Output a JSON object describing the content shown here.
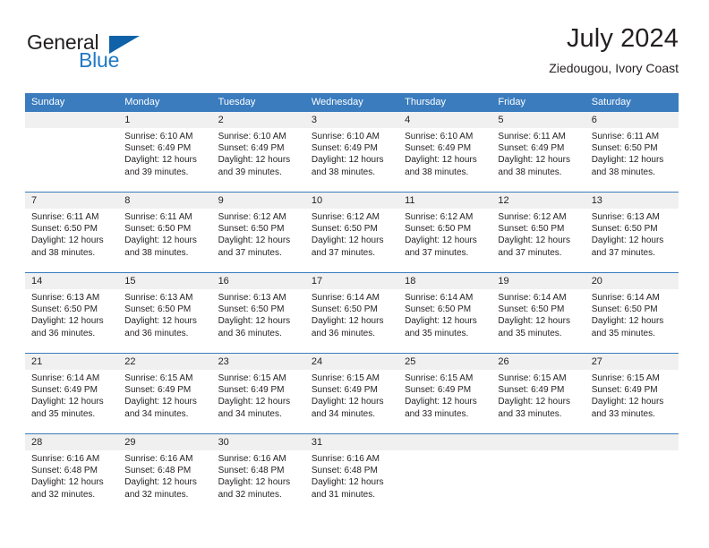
{
  "brand": {
    "name_part1": "General",
    "name_part2": "Blue",
    "triangle_color": "#0f62a8",
    "blue_color": "#2079c4"
  },
  "header": {
    "title": "July 2024",
    "subtitle": "Ziedougou, Ivory Coast"
  },
  "theme": {
    "header_bar_color": "#3a7cbe",
    "day_number_band_color": "#f0f0f0",
    "text_color": "#231f20"
  },
  "weekdays": [
    "Sunday",
    "Monday",
    "Tuesday",
    "Wednesday",
    "Thursday",
    "Friday",
    "Saturday"
  ],
  "weeks": [
    [
      {
        "day": "",
        "sunrise": "",
        "sunset": "",
        "daylight": "",
        "empty": true
      },
      {
        "day": "1",
        "sunrise": "Sunrise: 6:10 AM",
        "sunset": "Sunset: 6:49 PM",
        "daylight": "Daylight: 12 hours and 39 minutes."
      },
      {
        "day": "2",
        "sunrise": "Sunrise: 6:10 AM",
        "sunset": "Sunset: 6:49 PM",
        "daylight": "Daylight: 12 hours and 39 minutes."
      },
      {
        "day": "3",
        "sunrise": "Sunrise: 6:10 AM",
        "sunset": "Sunset: 6:49 PM",
        "daylight": "Daylight: 12 hours and 38 minutes."
      },
      {
        "day": "4",
        "sunrise": "Sunrise: 6:10 AM",
        "sunset": "Sunset: 6:49 PM",
        "daylight": "Daylight: 12 hours and 38 minutes."
      },
      {
        "day": "5",
        "sunrise": "Sunrise: 6:11 AM",
        "sunset": "Sunset: 6:49 PM",
        "daylight": "Daylight: 12 hours and 38 minutes."
      },
      {
        "day": "6",
        "sunrise": "Sunrise: 6:11 AM",
        "sunset": "Sunset: 6:50 PM",
        "daylight": "Daylight: 12 hours and 38 minutes."
      }
    ],
    [
      {
        "day": "7",
        "sunrise": "Sunrise: 6:11 AM",
        "sunset": "Sunset: 6:50 PM",
        "daylight": "Daylight: 12 hours and 38 minutes."
      },
      {
        "day": "8",
        "sunrise": "Sunrise: 6:11 AM",
        "sunset": "Sunset: 6:50 PM",
        "daylight": "Daylight: 12 hours and 38 minutes."
      },
      {
        "day": "9",
        "sunrise": "Sunrise: 6:12 AM",
        "sunset": "Sunset: 6:50 PM",
        "daylight": "Daylight: 12 hours and 37 minutes."
      },
      {
        "day": "10",
        "sunrise": "Sunrise: 6:12 AM",
        "sunset": "Sunset: 6:50 PM",
        "daylight": "Daylight: 12 hours and 37 minutes."
      },
      {
        "day": "11",
        "sunrise": "Sunrise: 6:12 AM",
        "sunset": "Sunset: 6:50 PM",
        "daylight": "Daylight: 12 hours and 37 minutes."
      },
      {
        "day": "12",
        "sunrise": "Sunrise: 6:12 AM",
        "sunset": "Sunset: 6:50 PM",
        "daylight": "Daylight: 12 hours and 37 minutes."
      },
      {
        "day": "13",
        "sunrise": "Sunrise: 6:13 AM",
        "sunset": "Sunset: 6:50 PM",
        "daylight": "Daylight: 12 hours and 37 minutes."
      }
    ],
    [
      {
        "day": "14",
        "sunrise": "Sunrise: 6:13 AM",
        "sunset": "Sunset: 6:50 PM",
        "daylight": "Daylight: 12 hours and 36 minutes."
      },
      {
        "day": "15",
        "sunrise": "Sunrise: 6:13 AM",
        "sunset": "Sunset: 6:50 PM",
        "daylight": "Daylight: 12 hours and 36 minutes."
      },
      {
        "day": "16",
        "sunrise": "Sunrise: 6:13 AM",
        "sunset": "Sunset: 6:50 PM",
        "daylight": "Daylight: 12 hours and 36 minutes."
      },
      {
        "day": "17",
        "sunrise": "Sunrise: 6:14 AM",
        "sunset": "Sunset: 6:50 PM",
        "daylight": "Daylight: 12 hours and 36 minutes."
      },
      {
        "day": "18",
        "sunrise": "Sunrise: 6:14 AM",
        "sunset": "Sunset: 6:50 PM",
        "daylight": "Daylight: 12 hours and 35 minutes."
      },
      {
        "day": "19",
        "sunrise": "Sunrise: 6:14 AM",
        "sunset": "Sunset: 6:50 PM",
        "daylight": "Daylight: 12 hours and 35 minutes."
      },
      {
        "day": "20",
        "sunrise": "Sunrise: 6:14 AM",
        "sunset": "Sunset: 6:50 PM",
        "daylight": "Daylight: 12 hours and 35 minutes."
      }
    ],
    [
      {
        "day": "21",
        "sunrise": "Sunrise: 6:14 AM",
        "sunset": "Sunset: 6:49 PM",
        "daylight": "Daylight: 12 hours and 35 minutes."
      },
      {
        "day": "22",
        "sunrise": "Sunrise: 6:15 AM",
        "sunset": "Sunset: 6:49 PM",
        "daylight": "Daylight: 12 hours and 34 minutes."
      },
      {
        "day": "23",
        "sunrise": "Sunrise: 6:15 AM",
        "sunset": "Sunset: 6:49 PM",
        "daylight": "Daylight: 12 hours and 34 minutes."
      },
      {
        "day": "24",
        "sunrise": "Sunrise: 6:15 AM",
        "sunset": "Sunset: 6:49 PM",
        "daylight": "Daylight: 12 hours and 34 minutes."
      },
      {
        "day": "25",
        "sunrise": "Sunrise: 6:15 AM",
        "sunset": "Sunset: 6:49 PM",
        "daylight": "Daylight: 12 hours and 33 minutes."
      },
      {
        "day": "26",
        "sunrise": "Sunrise: 6:15 AM",
        "sunset": "Sunset: 6:49 PM",
        "daylight": "Daylight: 12 hours and 33 minutes."
      },
      {
        "day": "27",
        "sunrise": "Sunrise: 6:15 AM",
        "sunset": "Sunset: 6:49 PM",
        "daylight": "Daylight: 12 hours and 33 minutes."
      }
    ],
    [
      {
        "day": "28",
        "sunrise": "Sunrise: 6:16 AM",
        "sunset": "Sunset: 6:48 PM",
        "daylight": "Daylight: 12 hours and 32 minutes."
      },
      {
        "day": "29",
        "sunrise": "Sunrise: 6:16 AM",
        "sunset": "Sunset: 6:48 PM",
        "daylight": "Daylight: 12 hours and 32 minutes."
      },
      {
        "day": "30",
        "sunrise": "Sunrise: 6:16 AM",
        "sunset": "Sunset: 6:48 PM",
        "daylight": "Daylight: 12 hours and 32 minutes."
      },
      {
        "day": "31",
        "sunrise": "Sunrise: 6:16 AM",
        "sunset": "Sunset: 6:48 PM",
        "daylight": "Daylight: 12 hours and 31 minutes."
      },
      {
        "day": "",
        "sunrise": "",
        "sunset": "",
        "daylight": "",
        "empty": true
      },
      {
        "day": "",
        "sunrise": "",
        "sunset": "",
        "daylight": "",
        "empty": true
      },
      {
        "day": "",
        "sunrise": "",
        "sunset": "",
        "daylight": "",
        "empty": true
      }
    ]
  ]
}
